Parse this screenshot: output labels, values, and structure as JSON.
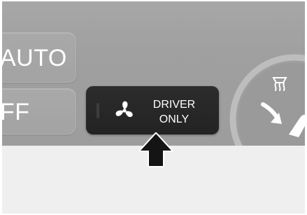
{
  "panel": {
    "auto_label": "AUTO",
    "off_label": "FF",
    "driver_button": {
      "line1": "DRIVER",
      "line2": "ONLY",
      "icon": "fan-icon"
    },
    "dial_icon": "rear-defrost-icon"
  },
  "callout": {
    "icon": "up-arrow-icon"
  },
  "colors": {
    "panel_background": "#a3a3a3",
    "button_dark": "#262626",
    "label_text": "#ffffff",
    "lower_area": "#efefef"
  }
}
